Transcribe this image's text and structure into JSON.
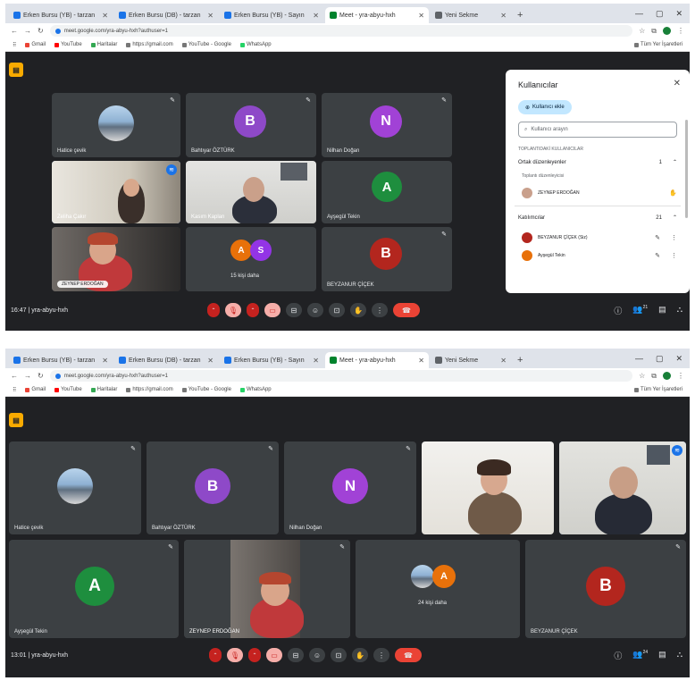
{
  "shot1": {
    "tabs": [
      {
        "label": "Erken Bursu (YB) - tarzan",
        "active": false
      },
      {
        "label": "Erken Bursu (DB) - tarzan",
        "active": false
      },
      {
        "label": "Erken Bursu (YB) - Sayın",
        "active": false
      },
      {
        "label": "Meet - yra-abyu-hxh",
        "active": true
      },
      {
        "label": "Yeni Sekme",
        "active": false
      }
    ],
    "url": "meet.google.com/yra-abyu-hxh?authuser=1",
    "bookmarks": [
      "Gmail",
      "YouTube",
      "Haritalar",
      "https://gmail.com",
      "YouTube - Google",
      "WhatsApp"
    ],
    "bookmarks_all": "Tüm Yer İşaretleri",
    "tiles": [
      {
        "name": "Hatice çevik",
        "kind": "photo"
      },
      {
        "name": "Bahtıyar ÖZTÜRK",
        "kind": "avatar",
        "letter": "B",
        "color": "#8e49c8"
      },
      {
        "name": "Nilhan Doğan",
        "kind": "avatar",
        "letter": "N",
        "color": "#a142d6"
      },
      {
        "name": "Zeliha Çakır",
        "kind": "video-woman"
      },
      {
        "name": "Kasım Kaplan",
        "kind": "video-man"
      },
      {
        "name": "Ayşegül Tekin",
        "kind": "avatar",
        "letter": "A",
        "color": "#1e8e3e"
      },
      {
        "name": "ZEYNEP ERDOĞAN",
        "kind": "video-woman2"
      },
      {
        "name": "15 kişi daha",
        "kind": "group",
        "letters": [
          "A",
          "S"
        ],
        "colors": [
          "#e8710a",
          "#9334e6"
        ]
      },
      {
        "name": "BEYZANUR ÇİÇEK",
        "kind": "avatar",
        "letter": "B",
        "color": "#b3261e"
      }
    ],
    "clock": "16:47 | yra-abyu-hxh",
    "panel": {
      "title": "Kullanıcılar",
      "add_label": "Kullanıcı ekle",
      "search_placeholder": "Kullanıcı arayın",
      "note": "TOPLANTIDAKİ KULLANICILAR",
      "group1": {
        "label": "Ortak düzenleyenler",
        "count": "1"
      },
      "group1_sub": "Toplantı düzenleyicisi",
      "person1": "ZEYNEP ERDOĞAN",
      "group2": {
        "label": "Katılımcılar",
        "count": "21"
      },
      "person2": "BEYZANUR ÇİÇEK (Siz)",
      "person3": "Ayşegül Tekin"
    },
    "badge_count": "21"
  },
  "shot2": {
    "tabs": [
      {
        "label": "Erken Bursu (YB) - tarzan",
        "active": false
      },
      {
        "label": "Erken Bursu (DB) - tarzan",
        "active": false
      },
      {
        "label": "Erken Bursu (YB) - Sayın",
        "active": false
      },
      {
        "label": "Meet - yra-abyu-hxh",
        "active": true
      },
      {
        "label": "Yeni Sekme",
        "active": false
      }
    ],
    "url": "meet.google.com/yra-abyu-hxh?authuser=1",
    "bookmarks": [
      "Gmail",
      "YouTube",
      "Haritalar",
      "https://gmail.com",
      "YouTube - Google",
      "WhatsApp"
    ],
    "bookmarks_all": "Tüm Yer İşaretleri",
    "tiles": [
      {
        "name": "Hatice çevik",
        "kind": "photo"
      },
      {
        "name": "Bahtıyar ÖZTÜRK",
        "kind": "avatar",
        "letter": "B",
        "color": "#8e49c8"
      },
      {
        "name": "Nilhan Doğan",
        "kind": "avatar",
        "letter": "N",
        "color": "#a142d6"
      },
      {
        "name": "",
        "kind": "video-woman-bright"
      },
      {
        "name": "",
        "kind": "video-man"
      },
      {
        "name": "Ayşegül Tekin",
        "kind": "avatar",
        "letter": "A",
        "color": "#1e8e3e"
      },
      {
        "name": "ZEYNEP ERDOĞAN",
        "kind": "video-woman2"
      },
      {
        "name": "24 kişi daha",
        "kind": "group",
        "letters": [
          "A"
        ],
        "colors": [
          "#e8710a"
        ]
      },
      {
        "name": "BEYZANUR ÇİÇEK",
        "kind": "avatar",
        "letter": "B",
        "color": "#b3261e"
      }
    ],
    "clock": "13:01 | yra-abyu-hxh",
    "badge_count": "24"
  }
}
